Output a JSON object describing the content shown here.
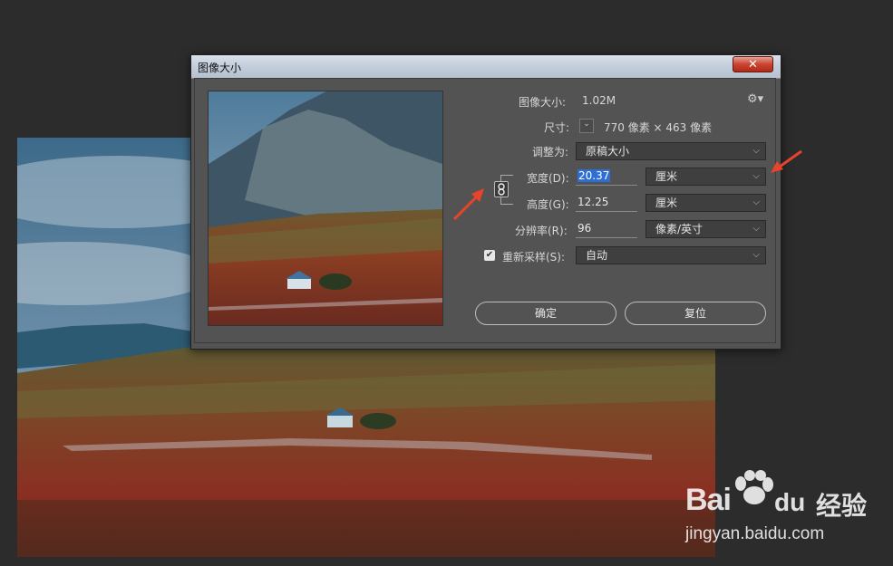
{
  "dialog": {
    "title": "图像大小",
    "close_glyph": "✕"
  },
  "info": {
    "image_size_label": "图像大小:",
    "image_size_value": "1.02M",
    "dimensions_label": "尺寸:",
    "dimensions_value": "770 像素 × 463 像素",
    "dimensions_dropdown_glyph": "⌄"
  },
  "fields": {
    "fit_to_label": "调整为:",
    "fit_to_value": "原稿大小",
    "width_label": "宽度(D):",
    "width_value": "20.37",
    "width_unit": "厘米",
    "height_label": "高度(G):",
    "height_value": "12.25",
    "height_unit": "厘米",
    "resolution_label": "分辨率(R):",
    "resolution_value": "96",
    "resolution_unit": "像素/英寸",
    "resample_label": "重新采样(S):",
    "resample_value": "自动",
    "resample_checked": true
  },
  "buttons": {
    "ok": "确定",
    "reset": "复位"
  },
  "watermark": {
    "brand_latin": "Bai",
    "brand_latin2": "du",
    "brand_cn": "经验",
    "url": "jingyan.baidu.com"
  },
  "icons": {
    "gear": "gear-icon",
    "link": "chain-link-icon",
    "chevron": "chevron-down-icon",
    "check": "checkmark-icon"
  },
  "colors": {
    "selection": "#2e6fd6",
    "annotation_arrow": "#e8432b",
    "dialog_bg": "#535353"
  }
}
